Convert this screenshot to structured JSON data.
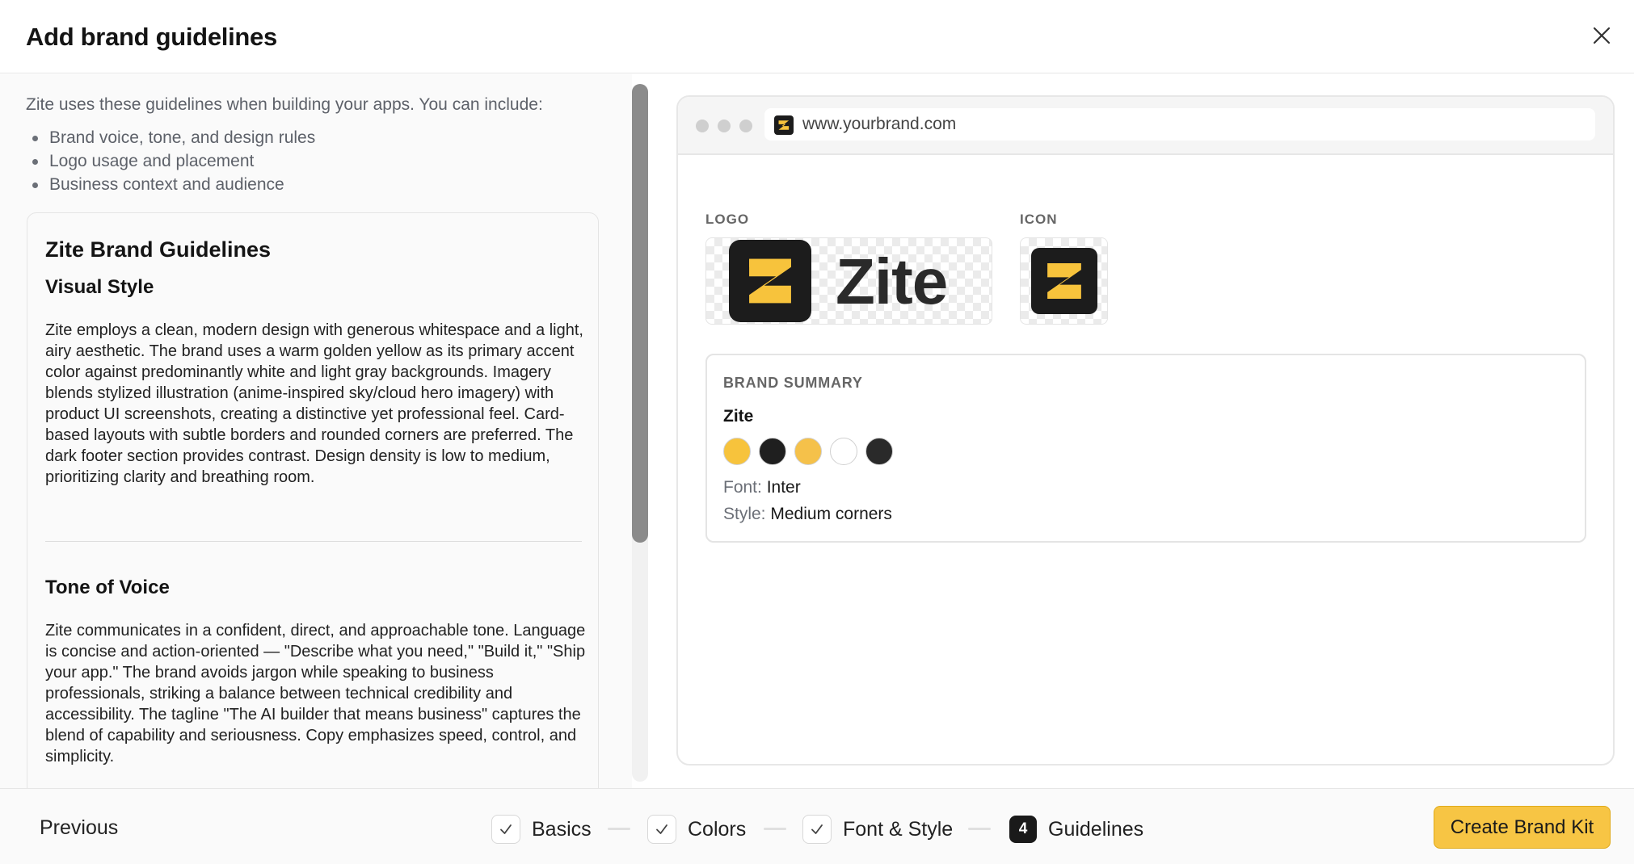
{
  "modal": {
    "title": "Add brand guidelines"
  },
  "left": {
    "intro": "Zite uses these guidelines when building your apps. You can include:",
    "bullets": [
      "Brand voice, tone, and design rules",
      "Logo usage and placement",
      "Business context and audience"
    ],
    "guide": {
      "h1": "Zite Brand Guidelines",
      "section1_title": "Visual Style",
      "section1_body": "Zite employs a clean, modern design with generous whitespace and a light, airy aesthetic. The brand uses a warm golden yellow as its primary accent color against predominantly white and light gray backgrounds. Imagery blends stylized illustration (anime-inspired sky/cloud hero imagery) with product UI screenshots, creating a distinctive yet professional feel. Card-based layouts with subtle borders and rounded corners are preferred. The dark footer section provides contrast. Design density is low to medium, prioritizing clarity and breathing room.",
      "section2_title": "Tone of Voice",
      "section2_body": "Zite communicates in a confident, direct, and approachable tone. Language is concise and action-oriented — \"Describe what you need,\" \"Build it,\" \"Ship your app.\" The brand avoids jargon while speaking to business professionals, striking a balance between technical credibility and accessibility. The tagline \"The AI builder that means business\" captures the blend of capability and seriousness. Copy emphasizes speed, control, and simplicity."
    }
  },
  "preview": {
    "url": "www.yourbrand.com",
    "logo_label": "LOGO",
    "icon_label": "ICON",
    "logo_word": "Zite",
    "summary": {
      "label": "BRAND SUMMARY",
      "name": "Zite",
      "colors": [
        "#F7C33C",
        "#1F1F1F",
        "#F5C14A",
        "#FFFFFF",
        "#2A2A2A"
      ],
      "font_label": "Font:",
      "font_value": "Inter",
      "style_label": "Style:",
      "style_value": "Medium corners"
    }
  },
  "footer": {
    "previous": "Previous",
    "steps": [
      {
        "label": "Basics",
        "state": "done"
      },
      {
        "label": "Colors",
        "state": "done"
      },
      {
        "label": "Font & Style",
        "state": "done"
      },
      {
        "label": "Guidelines",
        "state": "current",
        "number": "4"
      }
    ],
    "create": "Create Brand Kit"
  },
  "colors": {
    "accent": "#F7C544",
    "dark": "#1C1C1C"
  }
}
